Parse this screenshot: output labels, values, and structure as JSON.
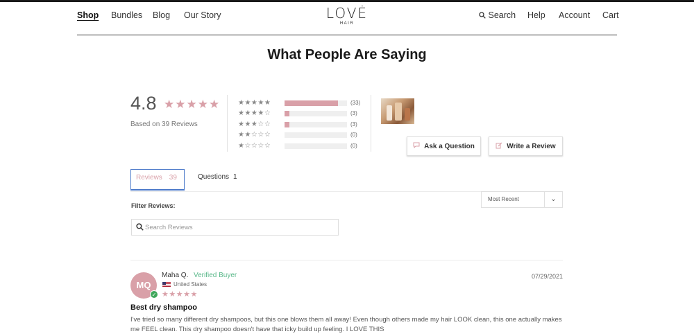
{
  "header": {
    "nav_left": [
      "Shop",
      "Bundles",
      "Blog",
      "Our Story"
    ],
    "logo_main": "LOVĖ",
    "logo_sub": "HAIR",
    "nav_right": {
      "search": "Search",
      "help": "Help",
      "account": "Account",
      "cart": "Cart"
    }
  },
  "page_title": "What People Are Saying",
  "summary": {
    "average": "4.8",
    "stars": "★★★★★",
    "based_on": "Based on 39 Reviews",
    "histogram": [
      {
        "stars": "★★★★★",
        "count_label": "(33)",
        "fraction": 0.85
      },
      {
        "stars": "★★★★☆",
        "count_label": "(3)",
        "fraction": 0.08
      },
      {
        "stars": "★★★☆☆",
        "count_label": "(3)",
        "fraction": 0.08
      },
      {
        "stars": "★★☆☆☆",
        "count_label": "(0)",
        "fraction": 0
      },
      {
        "stars": "★☆☆☆☆",
        "count_label": "(0)",
        "fraction": 0
      }
    ]
  },
  "actions": {
    "ask": "Ask a Question",
    "write": "Write a Review"
  },
  "tabs": {
    "reviews_label": "Reviews",
    "reviews_count": "39",
    "questions_label": "Questions",
    "questions_count": "1"
  },
  "filter": {
    "label": "Filter Reviews:",
    "search_placeholder": "Search Reviews",
    "sort_selected": "Most Recent"
  },
  "review": {
    "initials": "MQ",
    "name": "Maha Q.",
    "verified": "Verified Buyer",
    "country": "United States",
    "stars": "★★★★★",
    "date": "07/29/2021",
    "title": "Best dry shampoo",
    "body": "I've tried so many different dry shampoos, but this one blows them all away! Even though others made my hair LOOK clean, this one actually makes me FEEL clean. This dry shampoo doesn't have that icky build up feeling. I LOVE THIS"
  },
  "colors": {
    "accent": "#d9a0a8",
    "verified": "#5ab88a",
    "tab_border": "#4a78c9"
  }
}
